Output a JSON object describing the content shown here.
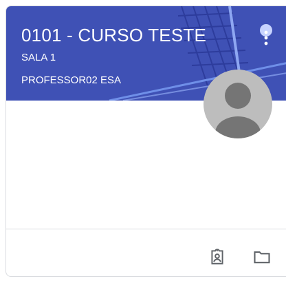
{
  "course": {
    "title": "0101 - CURSO TESTE",
    "section": "SALA 1",
    "teacher": "PROFESSOR02 ESA"
  },
  "colors": {
    "banner": "#3f51b5",
    "banner_accent": "#5c7be0",
    "avatar_bg": "#bdbdbd",
    "avatar_fg": "#757575",
    "icon": "#5f6368"
  },
  "icons": {
    "menu": "more-vert-icon",
    "avatar": "account-circle-icon",
    "work": "assignment-ind-icon",
    "folder": "folder-icon"
  }
}
